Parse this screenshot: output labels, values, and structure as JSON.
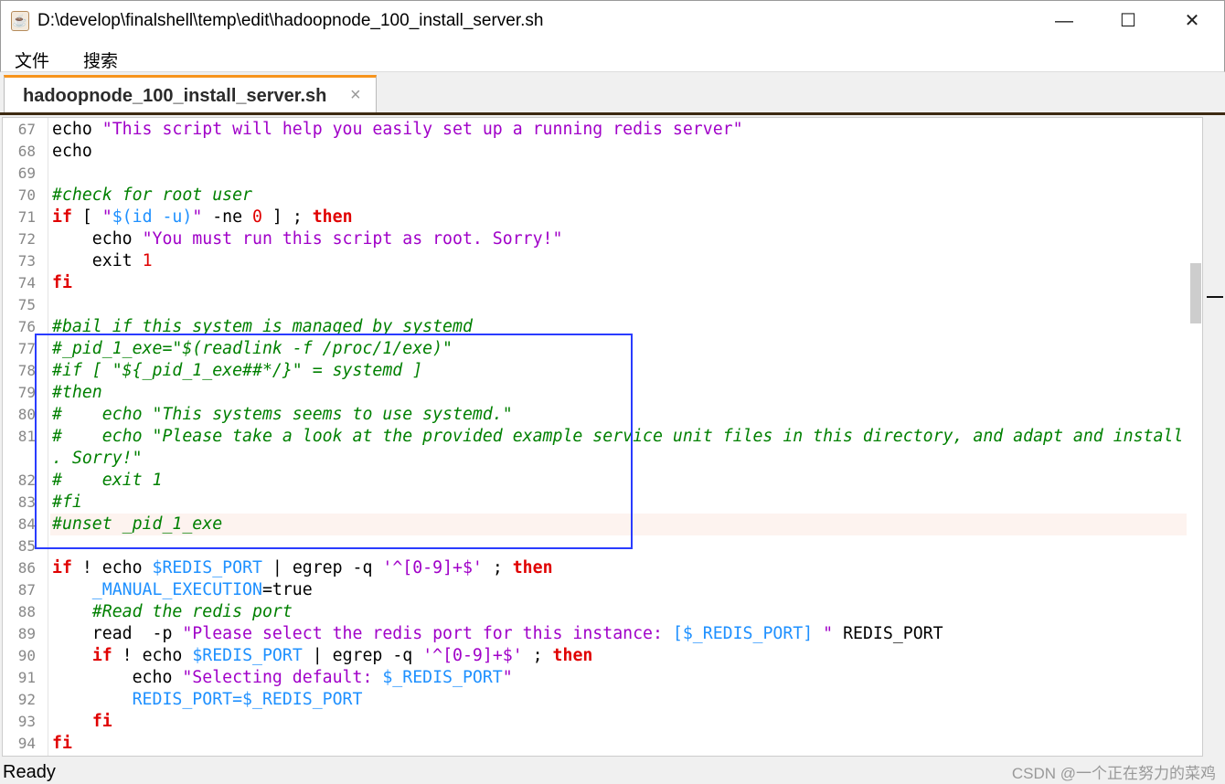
{
  "window": {
    "title": "D:\\develop\\finalshell\\temp\\edit\\hadoopnode_100_install_server.sh",
    "minimize": "—",
    "maximize": "☐",
    "close": "✕"
  },
  "menu": [
    "文件",
    "搜索"
  ],
  "tab": {
    "label": "hadoopnode_100_install_server.sh",
    "close": "×",
    "accent": "#f7941d"
  },
  "status": {
    "text": "Ready",
    "watermark": "CSDN @一个正在努力的菜鸡"
  },
  "highlight": {
    "box_color": "#2a3cff",
    "current_line": 84
  },
  "lines": [
    {
      "n": "67",
      "t": [
        [
          "",
          "echo "
        ],
        [
          "str",
          "\"This script will help you easily set up a running redis server\""
        ]
      ]
    },
    {
      "n": "68",
      "t": [
        [
          "",
          "echo"
        ]
      ]
    },
    {
      "n": "69",
      "t": []
    },
    {
      "n": "70",
      "t": [
        [
          "com",
          "#check for root user"
        ]
      ]
    },
    {
      "n": "71",
      "t": [
        [
          "kw",
          "if"
        ],
        [
          "",
          " [ "
        ],
        [
          "str",
          "\""
        ],
        [
          "var",
          "$(id -u)"
        ],
        [
          "str",
          "\""
        ],
        [
          "",
          " -ne "
        ],
        [
          "num",
          "0"
        ],
        [
          "",
          " ] ; "
        ],
        [
          "kw",
          "then"
        ]
      ]
    },
    {
      "n": "72",
      "t": [
        [
          "",
          "    echo "
        ],
        [
          "str",
          "\"You must run this script as root. Sorry!\""
        ]
      ]
    },
    {
      "n": "73",
      "t": [
        [
          "",
          "    exit "
        ],
        [
          "num",
          "1"
        ]
      ]
    },
    {
      "n": "74",
      "t": [
        [
          "kw",
          "fi"
        ]
      ]
    },
    {
      "n": "75",
      "t": []
    },
    {
      "n": "76",
      "t": [
        [
          "com",
          "#bail if this system is managed by systemd"
        ]
      ]
    },
    {
      "n": "77",
      "t": [
        [
          "com",
          "#_pid_1_exe=\"$(readlink -f /proc/1/exe)\""
        ]
      ]
    },
    {
      "n": "78",
      "t": [
        [
          "com",
          "#if [ \"${_pid_1_exe##*/}\" = systemd ]"
        ]
      ]
    },
    {
      "n": "79",
      "t": [
        [
          "com",
          "#then"
        ]
      ]
    },
    {
      "n": "80",
      "t": [
        [
          "com",
          "#    echo \"This systems seems to use systemd.\""
        ]
      ]
    },
    {
      "n": "81",
      "t": [
        [
          "com",
          "#    echo \"Please take a look at the provided example service unit files in this directory, and adapt and install"
        ]
      ]
    },
    {
      "n": "",
      "t": [
        [
          "com",
          ". Sorry!\""
        ]
      ]
    },
    {
      "n": "82",
      "t": [
        [
          "com",
          "#    exit 1"
        ]
      ]
    },
    {
      "n": "83",
      "t": [
        [
          "com",
          "#fi"
        ]
      ]
    },
    {
      "n": "84",
      "t": [
        [
          "com",
          "#unset _pid_1_exe"
        ]
      ]
    },
    {
      "n": "85",
      "t": []
    },
    {
      "n": "86",
      "t": [
        [
          "kw",
          "if"
        ],
        [
          "",
          " ! echo "
        ],
        [
          "var",
          "$REDIS_PORT"
        ],
        [
          "",
          " | egrep -q "
        ],
        [
          "str",
          "'^[0-9]+$'"
        ],
        [
          "",
          " ; "
        ],
        [
          "kw",
          "then"
        ]
      ]
    },
    {
      "n": "87",
      "t": [
        [
          "var",
          "    _MANUAL_EXECUTION"
        ],
        [
          "",
          "=true"
        ]
      ]
    },
    {
      "n": "88",
      "t": [
        [
          "com",
          "    #Read the redis port"
        ]
      ]
    },
    {
      "n": "89",
      "t": [
        [
          "",
          "    read  -p "
        ],
        [
          "str",
          "\"Please select the redis port for this instance: "
        ],
        [
          "var",
          "[$_REDIS_PORT]"
        ],
        [
          "str",
          " \""
        ],
        [
          "",
          " REDIS_PORT"
        ]
      ]
    },
    {
      "n": "90",
      "t": [
        [
          "",
          "    "
        ],
        [
          "kw",
          "if"
        ],
        [
          "",
          " ! echo "
        ],
        [
          "var",
          "$REDIS_PORT"
        ],
        [
          "",
          " | egrep -q "
        ],
        [
          "str",
          "'^[0-9]+$'"
        ],
        [
          "",
          " ; "
        ],
        [
          "kw",
          "then"
        ]
      ]
    },
    {
      "n": "91",
      "t": [
        [
          "",
          "        echo "
        ],
        [
          "str",
          "\"Selecting default: "
        ],
        [
          "var",
          "$_REDIS_PORT"
        ],
        [
          "str",
          "\""
        ]
      ]
    },
    {
      "n": "92",
      "t": [
        [
          "var",
          "        REDIS_PORT=$_REDIS_PORT"
        ]
      ]
    },
    {
      "n": "93",
      "t": [
        [
          "",
          "    "
        ],
        [
          "kw",
          "fi"
        ]
      ]
    },
    {
      "n": "94",
      "t": [
        [
          "kw",
          "fi"
        ]
      ]
    }
  ]
}
